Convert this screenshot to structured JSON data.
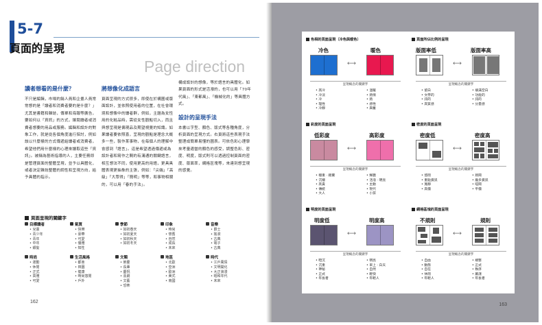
{
  "left": {
    "section_number": "5-7",
    "section_title": "頁面的呈現",
    "section_title_en": "Page direction",
    "columns": [
      {
        "heading": "讀者想看的是什麼？",
        "text": "不只是編輯，市場的銷人員和企畫人員常常想的是「讀者和消費者要的是什麼？」尤其是書籍和雜誌，傳單和海報等廣告，要如何以「資訊」的方式，讓閱讀者或消費者想要的用品或服務。編輯和設計的對象工作，就是從各個角度進行探討，例如該以什麼樣的方式傳遞給讀者或消費者，希望他們用什麼樣的心理來讀取這些「資訊」。被稱為藝術指導的人，主要任務即是管理頁面的整體呈現，並予以具體化，或者決定雜誌整體的調性和呈現方向，給予具體的指示。"
      },
      {
        "heading": "將想像化成語言",
        "text": "頁面呈現的方式很多，即使在於構圖或版面設計，並依照使用者的位置，在社會環境和想像中的讀者群，例如，主題為女性用的化粧品時，需從女性觀點切入，而且與想呈現是偏現品及期望視覺的知識。如果讀者要依照喜，呈現的觀點是理念大概多一些，製作某事物，在每個人的理解中會感到「語言」。這是希望透過傳遞或為設計者和寫作之間的有溝通的關鍵語言，相互想法不同，使用更高的用語，更具具體表現更抽象的主張，例如：「尖端」「高級」「大眾得」「簡明」等等，和事物相關的，可以用「春的手法」。"
      },
      {
        "heading": "",
        "text": "構成設計的想像，等於語言的具體化。如果頁面的形式是活潑的，也可以用「70年代風」、「東都風」、「機械化的」等具體方式。"
      },
      {
        "heading": "設計的呈現手法",
        "text": "本書以字型、顏色、版式等各種角度，分析頁面的呈現方式。右頁將這些表現手法整理成簡單易懂的圖表。可依色彩心理學來考量適當的顏色的感受，調整色彩、密度、明度，版式則可以透過控制頁面的密度、版面率，網格區塊等，來達到想呈現的感覺。"
      }
    ],
    "keywords_title": "頁面呈現的關鍵字",
    "keyword_groups": [
      {
        "title": "目標讀者",
        "items": [
          "兒童",
          "青少年",
          "青年",
          "中年",
          "銀髮"
        ]
      },
      {
        "title": "氣質",
        "items": [
          "快樂",
          "豪華",
          "可愛",
          "優雅",
          "知性"
        ]
      },
      {
        "title": "季節",
        "items": [
          "如初春天",
          "如初夏天",
          "如初秋天",
          "如初冬天"
        ]
      },
      {
        "title": "印象",
        "items": [
          "時尚",
          "懷舊",
          "自然",
          "成長",
          "未來"
        ]
      },
      {
        "title": "音樂",
        "items": [
          "爵士",
          "搖滾",
          "古典",
          "電子",
          "古典"
        ]
      },
      {
        "title": "時尚",
        "items": [
          "運動",
          "休閒",
          "正式",
          "高雅",
          "可愛"
        ]
      },
      {
        "title": "生活風格",
        "items": [
          "都會",
          "田園",
          "健康",
          "時尚悠閒",
          "戶外"
        ]
      },
      {
        "title": "文類",
        "items": [
          "節慶",
          "長輩",
          "慶祝",
          "喜劇",
          "文藝",
          "恐怖"
        ]
      },
      {
        "title": "地區",
        "items": [
          "北歐",
          "亞洲",
          "歐洲",
          "美式",
          "南國"
        ]
      },
      {
        "title": "時代",
        "items": [
          "江戶風情",
          "文明開化",
          "大正浪漫",
          "昭和年代",
          "未來"
        ]
      }
    ],
    "page_number": "162"
  },
  "right": {
    "page_number": "163",
    "panels": [
      {
        "title": "色相的頁面呈現（冷色與暖色）",
        "labels": [
          "冷色",
          "暖色"
        ],
        "concept": "呈現概念的關鍵字",
        "left_items": [
          "高冷",
          "冷淡",
          "冷",
          "理性",
          "冷靜"
        ],
        "right_items": [
          "溫暖",
          "熱情",
          "熱",
          "感性",
          "興奮"
        ]
      },
      {
        "title": "頁面所佔比例的呈現",
        "labels": [
          "版面率低",
          "版面率高"
        ],
        "concept": "呈現概念的關鍵字",
        "left_items": [
          "留白",
          "文學的",
          "訊的",
          "高質感"
        ],
        "right_items": [
          "填滿空白",
          "功能的",
          "訊的",
          "分量感"
        ]
      },
      {
        "title": "彩度的頁面呈現",
        "labels": [
          "低彩度",
          "高彩度"
        ],
        "concept": "呈現概念的關鍵字",
        "left_items": [
          "穩重 · 踏實",
          "沉穩",
          "高貴",
          "傳統",
          "大人"
        ],
        "right_items": [
          "鮮艷",
          "活潑 · 明亮",
          "主動",
          "現代",
          "小孩"
        ]
      },
      {
        "title": "密度的頁面呈現",
        "labels": [
          "密度低",
          "密度高"
        ],
        "concept": "呈現概念的關鍵字",
        "left_items": [
          "悠閒",
          "重點資訊",
          "寬靜",
          "高價"
        ],
        "right_items": [
          "熱鬧",
          "龐多資訊",
          "喧鬧",
          "平價"
        ]
      },
      {
        "title": "明度的頁面呈現",
        "labels": [
          "明度低",
          "明度高"
        ],
        "concept": "呈現概念的關鍵字",
        "left_items": [
          "暗沉",
          "沉重",
          "神秘",
          "正式",
          "年長者"
        ],
        "right_items": [
          "明亮",
          "早上 · 白天",
          "自然",
          "輕快",
          "年輕人"
        ]
      },
      {
        "title": "網格區塊的頁面呈現",
        "labels": [
          "不規則",
          "規則"
        ],
        "concept": "呈現概念的關鍵字",
        "left_items": [
          "自由",
          "動態",
          "自在",
          "休閒",
          "年輕人"
        ],
        "right_items": [
          "規整",
          "正式",
          "秩序",
          "嚴謹",
          "年長者"
        ]
      }
    ]
  },
  "colors": {
    "accent": "#1f4e9a",
    "cool": "#1e6fd0",
    "warm": "#e8184f",
    "low_sat": "#c98aa0",
    "high_sat": "#ef6fab",
    "low_light": "#5b5470",
    "high_light": "#9c94c4",
    "right_bg": "#9d9da4"
  }
}
